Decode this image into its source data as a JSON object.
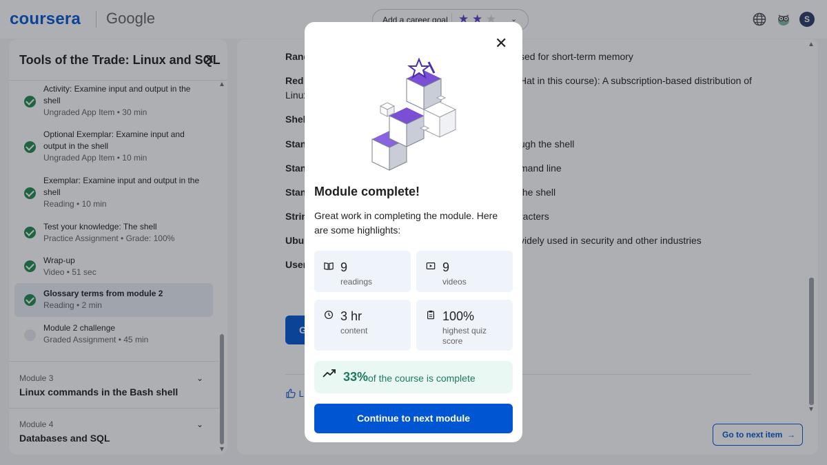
{
  "header": {
    "brand": "coursera",
    "partner": "Google",
    "goal_label": "Add a career goal",
    "goal_stars_filled": 2,
    "goal_stars_total": 3,
    "avatar_initial": "S"
  },
  "sidebar": {
    "title": "Tools of the Trade: Linux and SQL",
    "lessons": [
      {
        "title": "Activity: Examine input and output in the shell",
        "meta": "Ungraded App Item • 30 min",
        "done": true
      },
      {
        "title": "Optional Exemplar: Examine input and output in the shell",
        "meta": "Ungraded App Item • 10 min",
        "done": true
      },
      {
        "title": "Exemplar: Examine input and output in the shell",
        "meta": "Reading • 10 min",
        "done": true
      },
      {
        "title": "Test your knowledge: The shell",
        "meta": "Practice Assignment • Grade: 100%",
        "done": true
      },
      {
        "title": "Wrap-up",
        "meta": "Video • 51 sec",
        "done": true
      },
      {
        "title": "Glossary terms from module 2",
        "meta": "Reading • 2 min",
        "done": true,
        "active": true
      },
      {
        "title": "Module 2 challenge",
        "meta": "Graded Assignment • 45 min",
        "done": false
      }
    ],
    "modules": [
      {
        "number": "Module 3",
        "name": "Linux commands in the Bash shell"
      },
      {
        "number": "Module 4",
        "name": "Databases and SQL"
      }
    ]
  },
  "main": {
    "glossary": [
      {
        "term": "Rand",
        "text": "sed for short-term memory"
      },
      {
        "term": "Red I",
        "text": "Hat in this course): A subscription-based distribution of"
      },
      {
        "term": "Shel",
        "text": ""
      },
      {
        "term": "Stan",
        "text": "ugh the shell"
      },
      {
        "term": "Stan",
        "text": "mand line"
      },
      {
        "term": "Stan",
        "text": "the shell"
      },
      {
        "term": "Strin",
        "text": "racters"
      },
      {
        "term": "Ubur",
        "text": "videly used in security and other industries"
      },
      {
        "term": "User",
        "text": ""
      }
    ],
    "linux_fragment": "Linux",
    "button_fragment": "G",
    "like_fragment": "L",
    "next_item_label": "Go to next item"
  },
  "modal": {
    "title": "Module complete!",
    "text": "Great work in completing the module. Here are some highlights:",
    "stats": [
      {
        "icon": "book-icon",
        "value": "9",
        "label": "readings"
      },
      {
        "icon": "video-icon",
        "value": "9",
        "label": "videos"
      },
      {
        "icon": "clock-icon",
        "value": "3 hr",
        "label": "content"
      },
      {
        "icon": "clipboard-icon",
        "value": "100%",
        "label": "highest quiz score"
      }
    ],
    "progress_percent": "33%",
    "progress_text": "of the course is complete",
    "continue_label": "Continue to next module"
  },
  "colors": {
    "brand": "#0056d2",
    "success": "#1e8a4c",
    "progress_text": "#1d7a58",
    "accent_purple": "#5b3ec9"
  }
}
